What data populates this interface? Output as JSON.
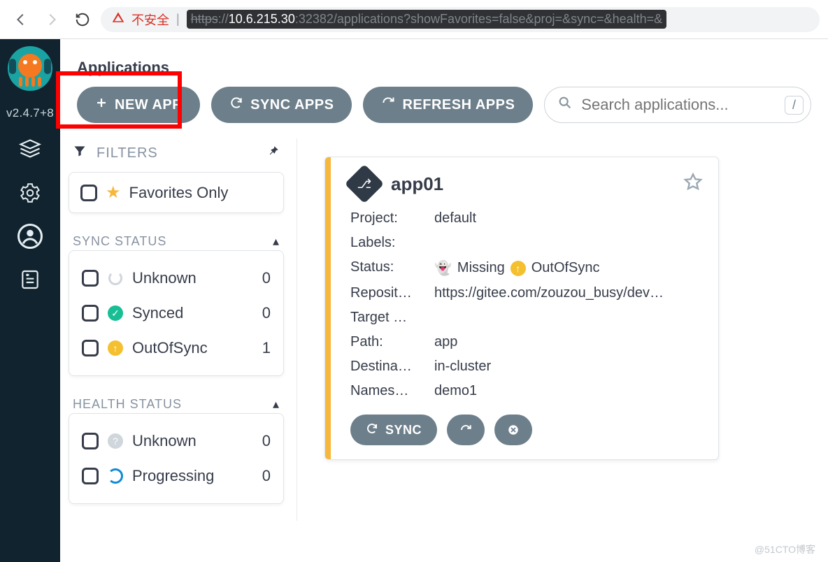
{
  "browser": {
    "insecure_label": "不安全",
    "scheme": "https",
    "host": "10.6.215.30",
    "port": ":32382",
    "path": "/applications?showFavorites=false&proj=&sync=&health=&"
  },
  "sidebar": {
    "version": "v2.4.7+8"
  },
  "page": {
    "title": "Applications"
  },
  "toolbar": {
    "new_app": "NEW APP",
    "sync_apps": "SYNC APPS",
    "refresh_apps": "REFRESH APPS",
    "search_placeholder": "Search applications...",
    "slash_hint": "/"
  },
  "filters": {
    "header": "FILTERS",
    "favorites": "Favorites Only",
    "sync_status_title": "SYNC STATUS",
    "sync_status": [
      {
        "label": "Unknown",
        "count": "0"
      },
      {
        "label": "Synced",
        "count": "0"
      },
      {
        "label": "OutOfSync",
        "count": "1"
      }
    ],
    "health_status_title": "HEALTH STATUS",
    "health_status": [
      {
        "label": "Unknown",
        "count": "0"
      },
      {
        "label": "Progressing",
        "count": "0"
      }
    ]
  },
  "app": {
    "name": "app01",
    "labels": {
      "project": "Project:",
      "labels": "Labels:",
      "status": "Status:",
      "repo": "Reposit…",
      "target": "Target …",
      "path": "Path:",
      "dest": "Destina…",
      "ns": "Names…"
    },
    "values": {
      "project": "default",
      "labels": "",
      "status_missing": "Missing",
      "status_oos": "OutOfSync",
      "repo": "https://gitee.com/zouzou_busy/dev…",
      "target": "",
      "path": "app",
      "dest": "in-cluster",
      "ns": "demo1"
    },
    "actions": {
      "sync": "SYNC"
    }
  },
  "watermark": "@51CTO博客"
}
